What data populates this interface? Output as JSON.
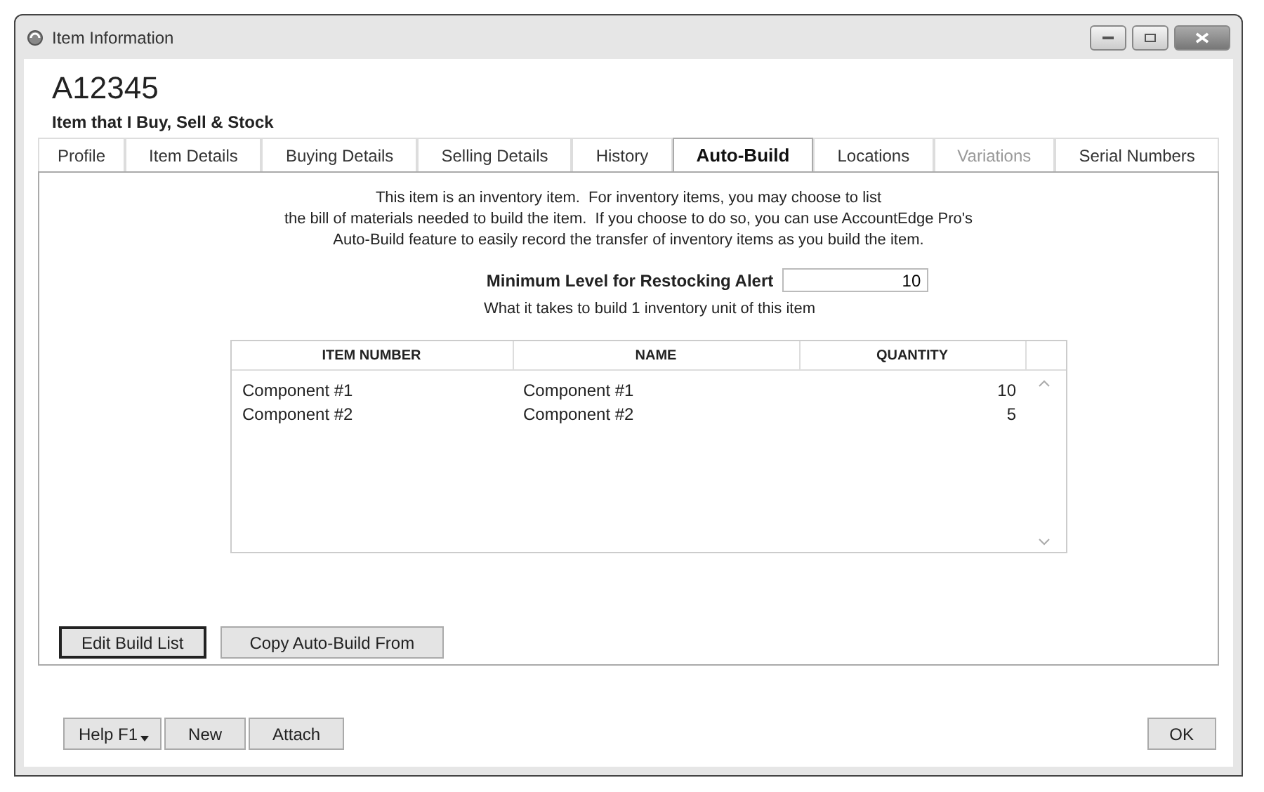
{
  "window": {
    "title": "Item Information"
  },
  "item_number": "A12345",
  "item_type": "Item that I Buy, Sell & Stock",
  "tabs": [
    {
      "label": "Profile",
      "selected": false,
      "disabled": false
    },
    {
      "label": "Item Details",
      "selected": false,
      "disabled": false
    },
    {
      "label": "Buying Details",
      "selected": false,
      "disabled": false
    },
    {
      "label": "Selling Details",
      "selected": false,
      "disabled": false
    },
    {
      "label": "History",
      "selected": false,
      "disabled": false
    },
    {
      "label": "Auto-Build",
      "selected": true,
      "disabled": false
    },
    {
      "label": "Locations",
      "selected": false,
      "disabled": false
    },
    {
      "label": "Variations",
      "selected": false,
      "disabled": true
    },
    {
      "label": "Serial Numbers",
      "selected": false,
      "disabled": false
    }
  ],
  "description": [
    "This item is an inventory item.  For inventory items, you may choose to list",
    "the bill of materials needed to build the item.  If you choose to do so, you can use AccountEdge Pro's",
    "Auto-Build feature to easily record the transfer of inventory items as you build the item."
  ],
  "restock": {
    "label": "Minimum Level for Restocking Alert",
    "value": "10"
  },
  "build_caption": "What it takes to build 1 inventory unit of this item",
  "table": {
    "columns": [
      "ITEM NUMBER",
      "NAME",
      "QUANTITY"
    ],
    "rows": [
      [
        "Component #1",
        "Component #1",
        "10"
      ],
      [
        "Component #2",
        "Component #2",
        "5"
      ]
    ]
  },
  "panel_buttons": [
    {
      "label": "Edit Build List",
      "default": true
    },
    {
      "label": "Copy Auto-Build From",
      "default": false
    }
  ],
  "footer_buttons": [
    {
      "label": "Help F1",
      "dropdown": true
    },
    {
      "label": "New",
      "dropdown": false
    },
    {
      "label": "Attach",
      "dropdown": false
    }
  ],
  "ok_button": "OK"
}
